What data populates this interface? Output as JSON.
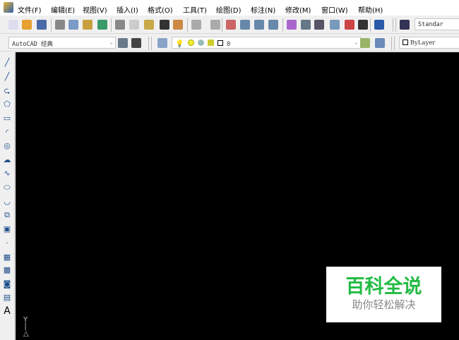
{
  "menu": [
    "文件(F)",
    "编辑(E)",
    "视图(V)",
    "插入(I)",
    "格式(O)",
    "工具(T)",
    "绘图(D)",
    "标注(N)",
    "修改(M)",
    "窗口(W)",
    "帮助(H)"
  ],
  "toolbar1": {
    "icons": [
      "new-icon",
      "open-icon",
      "save-icon",
      "print-icon",
      "plot-preview-icon",
      "publish-icon",
      "3d-dwf-icon",
      "cut-icon",
      "copy-icon",
      "paste-icon",
      "match-properties-icon",
      "block-editor-icon",
      "undo-icon",
      "redo-icon",
      "pan-icon",
      "zoom-realtime-icon",
      "zoom-window-icon",
      "zoom-previous-icon",
      "properties-icon",
      "design-center-icon",
      "tool-palettes-icon",
      "sheet-set-icon",
      "markup-icon",
      "calculator-icon",
      "help-icon",
      "text-style-icon"
    ],
    "text_style": "Standar"
  },
  "toolbar2": {
    "workspace": "AutoCAD 经典",
    "layer": "0",
    "color": "ByLayer"
  },
  "left_tools": [
    "line",
    "construction-line",
    "polyline",
    "polygon",
    "rectangle",
    "arc",
    "circle",
    "revision-cloud",
    "spline",
    "ellipse",
    "ellipse-arc",
    "insert-block",
    "make-block",
    "point",
    "hatch",
    "gradient",
    "region",
    "table",
    "multiline-text"
  ],
  "watermark": {
    "title": "百科全说",
    "subtitle": "助你轻松解决",
    "color": "#22bb44"
  },
  "ucs": {
    "y": "Y"
  }
}
